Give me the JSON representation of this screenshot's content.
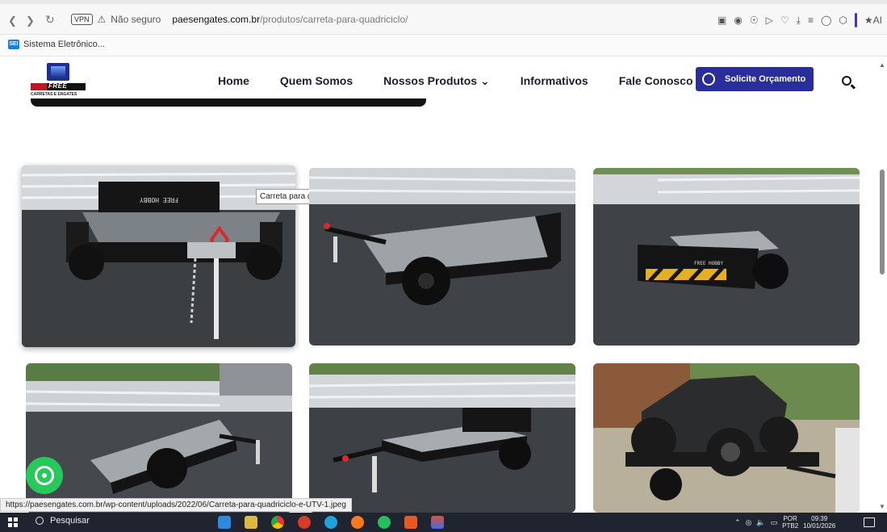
{
  "browser": {
    "vpn_label": "VPN",
    "security": "Não seguro",
    "url_host": "paesengates.com.br",
    "url_path": "/produtos/carreta-para-quadriciclo/",
    "bookmark": "Sistema Eletrônico...",
    "bookmark_icon_text": "SEI",
    "ai_label": "AI"
  },
  "site": {
    "logo": {
      "brand": "FREE HOBBY",
      "sub": "CARRETAS E ENGATES"
    },
    "nav": [
      "Home",
      "Quem Somos",
      "Nossos Produtos ⌄",
      "Informativos",
      "Fale Conosco"
    ],
    "cta": "Solicite Orçamento"
  },
  "gallery": {
    "tooltip": "Carreta para quadriciclo",
    "trailer_plate_text": "FREE HOBBY"
  },
  "status_url": "https://paesengates.com.br/wp-content/uploads/2022/06/Carreta-para-quadriciclo-e-UTV-1.jpeg",
  "taskbar": {
    "search": "Pesquisar",
    "lang": "POR",
    "lang2": "PTB2",
    "time": "09:39",
    "date": "10/01/2026"
  },
  "colors": {
    "cta": "#2a2e9a",
    "whatsapp": "#27c95a",
    "taskbar": "#1f2430"
  }
}
